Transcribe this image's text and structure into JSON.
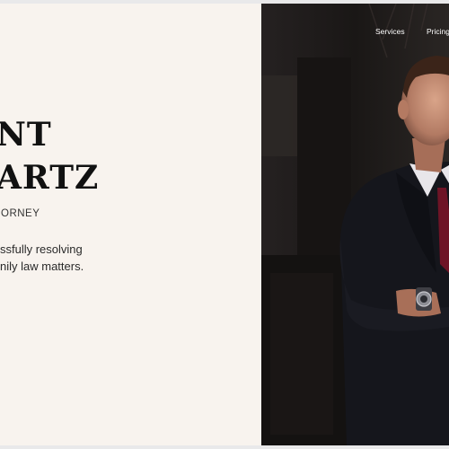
{
  "hero": {
    "name_line1": "NT",
    "name_line2": "ARTZ",
    "role": "ORNEY",
    "tagline_line1": "ssfully resolving",
    "tagline_line2": "nily law matters."
  },
  "nav": {
    "items": [
      "Services",
      "Pricing"
    ]
  },
  "colors": {
    "left_bg": "#f8f3ee",
    "photo_bg": "#1d1a19",
    "tie": "#6e1426"
  },
  "photo": {
    "subject": "man in dark suit with burgundy tie and wristwatch"
  }
}
